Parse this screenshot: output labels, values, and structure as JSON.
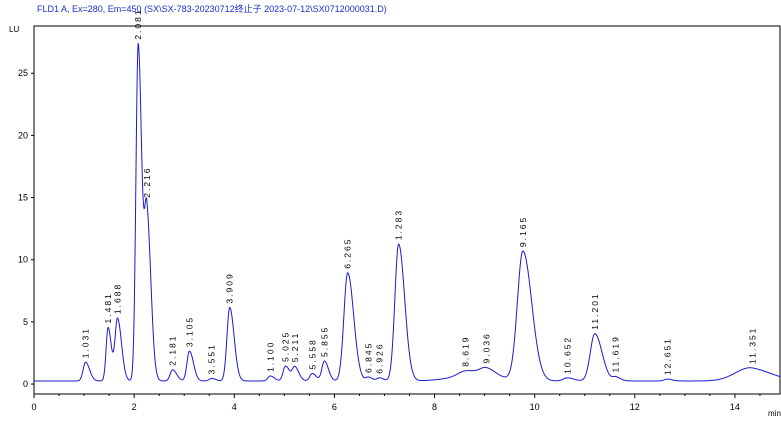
{
  "chart_data": {
    "type": "line",
    "title": "FLD1 A, Ex=280, Em=450 (SX\\SX-783-20230712终止子 2023-07-12\\SX0712000031.D)",
    "ylabel": "LU",
    "xlabel": "min",
    "xlim": [
      0,
      14.9
    ],
    "ylim": [
      -0.8,
      28.8
    ],
    "x_ticks": [
      0,
      2,
      4,
      6,
      8,
      10,
      12,
      14
    ],
    "y_ticks": [
      0,
      5,
      10,
      15,
      20,
      25
    ],
    "baseline": 0.25,
    "grid": false,
    "color": "#1a1ad0",
    "peaks": [
      {
        "label": "1.031",
        "rt": 1.031,
        "height": 1.5,
        "width": 0.05
      },
      {
        "label": "1.481",
        "rt": 1.48,
        "height": 4.3,
        "width": 0.04
      },
      {
        "label": "1.688",
        "rt": 1.668,
        "height": 5.0,
        "width": 0.05
      },
      {
        "label": "2.081",
        "rt": 2.081,
        "height": 27.1,
        "width": 0.045
      },
      {
        "label": "2.216",
        "rt": 2.256,
        "height": 13.0,
        "width": 0.05
      },
      {
        "label": "2.181",
        "rt": 2.77,
        "height": 0.9,
        "width": 0.05
      },
      {
        "label": "3.105",
        "rt": 3.105,
        "height": 2.4,
        "width": 0.05
      },
      {
        "label": "3.551",
        "rt": 3.55,
        "height": 0.2,
        "width": 0.05
      },
      {
        "label": "3.909",
        "rt": 3.909,
        "height": 5.9,
        "width": 0.055
      },
      {
        "label": "1.100",
        "rt": 4.72,
        "height": 0.4,
        "width": 0.05
      },
      {
        "label": "5.025",
        "rt": 5.025,
        "height": 1.2,
        "width": 0.05
      },
      {
        "label": "5.211",
        "rt": 5.211,
        "height": 1.1,
        "width": 0.05
      },
      {
        "label": "5.558",
        "rt": 5.558,
        "height": 0.6,
        "width": 0.05
      },
      {
        "label": "5.855",
        "rt": 5.8,
        "height": 1.6,
        "width": 0.05
      },
      {
        "label": "6.265",
        "rt": 6.265,
        "height": 8.7,
        "width": 0.075
      },
      {
        "label": "6.845",
        "rt": 6.68,
        "height": 0.3,
        "width": 0.05
      },
      {
        "label": "6.926",
        "rt": 6.9,
        "height": 0.25,
        "width": 0.05
      },
      {
        "label": "1.283",
        "rt": 7.283,
        "height": 11.0,
        "width": 0.075
      },
      {
        "label": "8.619",
        "rt": 8.619,
        "height": 0.4,
        "width": 0.15
      },
      {
        "label": "9.036",
        "rt": 9.036,
        "height": 0.6,
        "width": 0.12
      },
      {
        "label": "9.165",
        "rt": 9.765,
        "height": 10.4,
        "width": 0.11
      },
      {
        "label": "10.652",
        "rt": 10.652,
        "height": 0.25,
        "width": 0.08
      },
      {
        "label": "11.201",
        "rt": 11.201,
        "height": 3.8,
        "width": 0.09
      },
      {
        "label": "11.619",
        "rt": 11.619,
        "height": 0.3,
        "width": 0.06
      },
      {
        "label": "12.651",
        "rt": 12.651,
        "height": 0.15,
        "width": 0.06
      },
      {
        "label": "11.351",
        "rt": 14.351,
        "height": 0.9,
        "width": 0.25
      }
    ],
    "bumps": [
      {
        "rt": 8.8,
        "height": 0.45,
        "width": 0.45
      },
      {
        "rt": 14.05,
        "height": 0.3,
        "width": 0.25
      }
    ]
  }
}
